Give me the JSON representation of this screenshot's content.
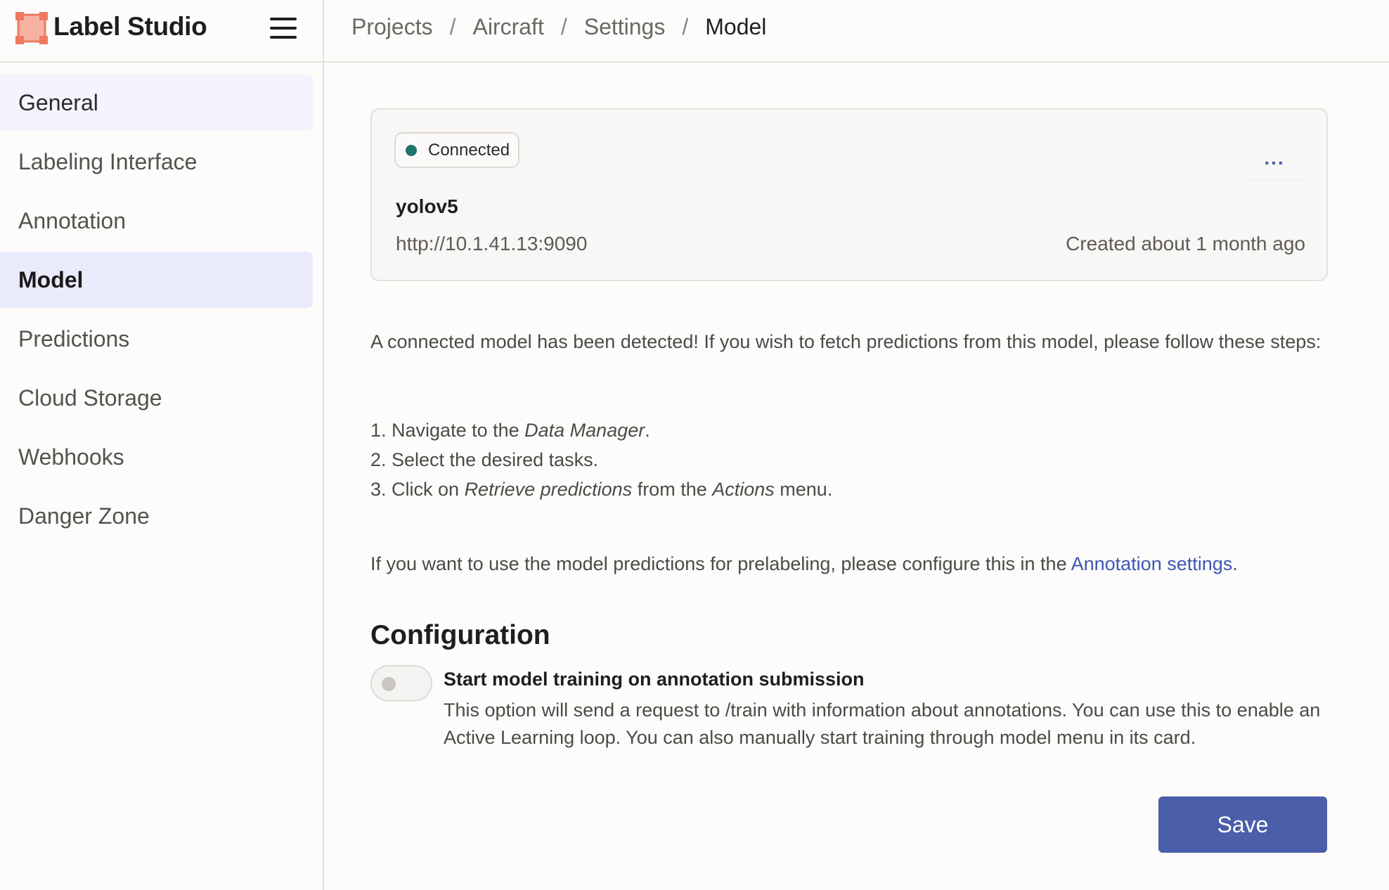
{
  "app": {
    "name": "Label Studio",
    "accent_color": "#4a5ea9",
    "logo_color": "#ee7a5f"
  },
  "breadcrumb": [
    "Projects",
    "Aircraft",
    "Settings",
    "Model"
  ],
  "breadcrumb_separator": "/",
  "sidebar": {
    "items": [
      {
        "label": "General"
      },
      {
        "label": "Labeling Interface"
      },
      {
        "label": "Annotation"
      },
      {
        "label": "Model",
        "active": true
      },
      {
        "label": "Predictions"
      },
      {
        "label": "Cloud Storage"
      },
      {
        "label": "Webhooks"
      },
      {
        "label": "Danger Zone"
      }
    ]
  },
  "model_card": {
    "status": "Connected",
    "status_color": "#1f7569",
    "menu_label": "...",
    "name": "yolov5",
    "url": "http://10.1.41.13:9090",
    "created": "Created about 1 month ago"
  },
  "instructions": {
    "intro": "A connected model has been detected! If you wish to fetch predictions from this model, please follow these steps:",
    "step1_prefix": "1. Navigate to the ",
    "step1_em": "Data Manager",
    "step1_suffix": ".",
    "step2": "2. Select the desired tasks.",
    "step3_prefix": "3. Click on ",
    "step3_em1": "Retrieve predictions",
    "step3_mid": " from the ",
    "step3_em2": "Actions",
    "step3_suffix": " menu.",
    "prelabel_text": "If you want to use the model predictions for prelabeling, please configure this in the ",
    "prelabel_link": "Annotation settings",
    "prelabel_suffix": "."
  },
  "configuration": {
    "title": "Configuration",
    "toggle_checked": false,
    "toggle_title": "Start model training on annotation submission",
    "toggle_desc": "This option will send a request to /train with information about annotations. You can use this to enable an Active Learning loop. You can also manually start training through model menu in its card."
  },
  "save_label": "Save"
}
